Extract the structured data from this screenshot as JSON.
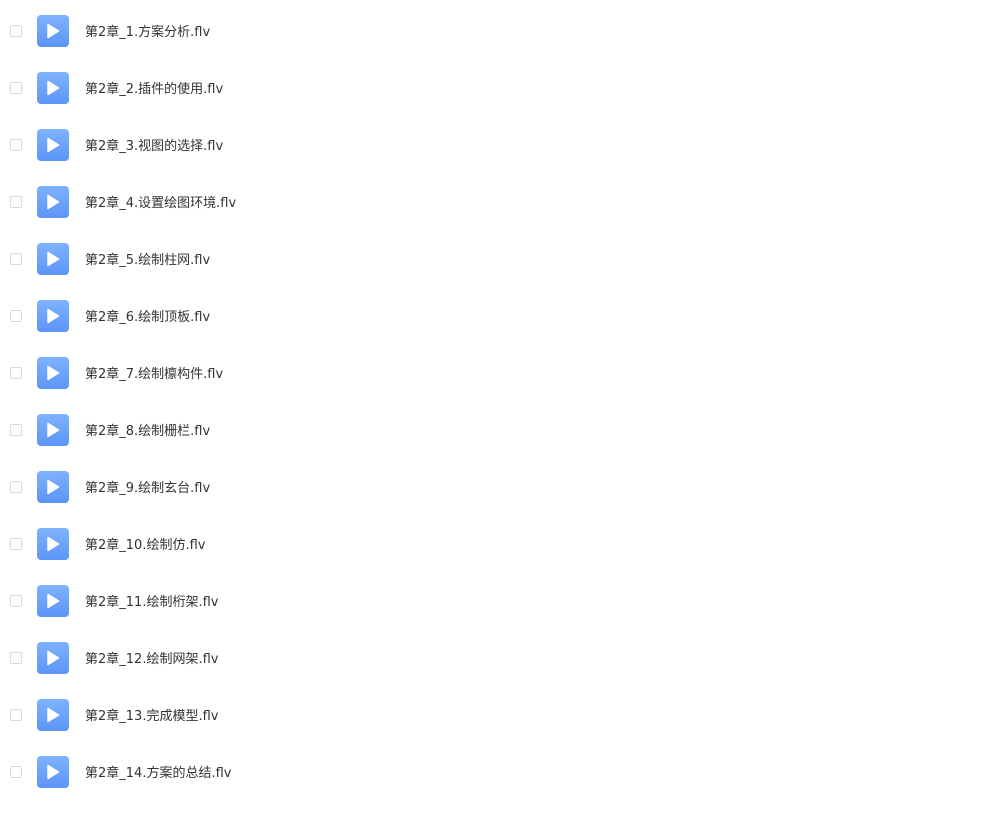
{
  "files": [
    {
      "name": "第2章_1.方案分析.flv",
      "icon": "video-file-icon"
    },
    {
      "name": "第2章_2.插件的使用.flv",
      "icon": "video-file-icon"
    },
    {
      "name": "第2章_3.视图的选择.flv",
      "icon": "video-file-icon"
    },
    {
      "name": "第2章_4.设置绘图环境.flv",
      "icon": "video-file-icon"
    },
    {
      "name": "第2章_5.绘制柱网.flv",
      "icon": "video-file-icon"
    },
    {
      "name": "第2章_6.绘制顶板.flv",
      "icon": "video-file-icon"
    },
    {
      "name": "第2章_7.绘制檩构件.flv",
      "icon": "video-file-icon"
    },
    {
      "name": "第2章_8.绘制栅栏.flv",
      "icon": "video-file-icon"
    },
    {
      "name": "第2章_9.绘制玄台.flv",
      "icon": "video-file-icon"
    },
    {
      "name": "第2章_10.绘制仿.flv",
      "icon": "video-file-icon"
    },
    {
      "name": "第2章_11.绘制桁架.flv",
      "icon": "video-file-icon"
    },
    {
      "name": "第2章_12.绘制网架.flv",
      "icon": "video-file-icon"
    },
    {
      "name": "第2章_13.完成模型.flv",
      "icon": "video-file-icon"
    },
    {
      "name": "第2章_14.方案的总结.flv",
      "icon": "video-file-icon"
    }
  ],
  "colors": {
    "icon_gradient_top": "#7fb2ff",
    "icon_gradient_bottom": "#5b95f7",
    "text": "#333333",
    "checkbox_border": "#d9d9d9"
  }
}
